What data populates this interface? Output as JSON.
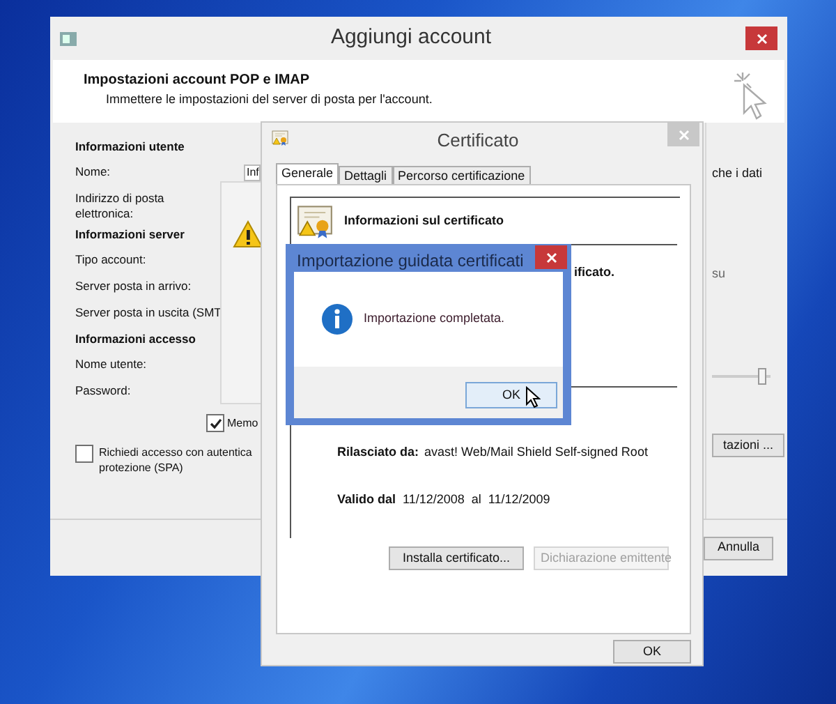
{
  "main_window": {
    "title": "Aggiungi account",
    "header_title": "Impostazioni account POP e IMAP",
    "header_subtitle": "Immettere le impostazioni del server di posta per l'account.",
    "form_rows": [
      {
        "kind": "heading",
        "text": "Informazioni utente"
      },
      {
        "kind": "label",
        "text": "Nome:"
      },
      {
        "kind": "label",
        "text": "Indirizzo di posta elettronica:"
      },
      {
        "kind": "heading",
        "text": "Informazioni server"
      },
      {
        "kind": "label",
        "text": "Tipo account:"
      },
      {
        "kind": "label",
        "text": "Server posta in arrivo:"
      },
      {
        "kind": "label",
        "text": "Server posta in uscita (SMT"
      },
      {
        "kind": "heading",
        "text": "Informazioni accesso"
      },
      {
        "kind": "label",
        "text": "Nome utente:"
      },
      {
        "kind": "label",
        "text": "Password:"
      }
    ],
    "name_field": {
      "value": "Inf"
    },
    "remember_checkbox": {
      "label": "Memo",
      "checked": true
    },
    "spa_checkbox": {
      "lines": [
        "Richiedi accesso con autentica",
        "protezione (SPA)"
      ],
      "checked": false
    },
    "right_texts": [
      "che i dati",
      "su"
    ],
    "slider": {
      "level": 0.92
    },
    "settings_button": "tazioni ...",
    "cancel_button": "Annulla"
  },
  "certificate_window": {
    "title": "Certificato",
    "tabs": [
      {
        "label": "Generale",
        "selected": true
      },
      {
        "label": "Dettagli",
        "selected": false
      },
      {
        "label": "Percorso certificazione",
        "selected": false
      }
    ],
    "heading": "Informazioni sul certificato",
    "partial_text": "ificato.",
    "issued_by_label": "Rilasciato da:",
    "issued_by": "avast! Web/Mail Shield Self-signed Root",
    "valid_label": "Valido dal",
    "valid_from": "11/12/2008",
    "valid_to_label": "al",
    "valid_to": "11/12/2009",
    "buttons": [
      {
        "label": "Installa certificato...",
        "disabled": false
      },
      {
        "label": "Dichiarazione emittente",
        "disabled": true
      }
    ],
    "ok_button": "OK"
  },
  "import_dialog": {
    "title": "Importazione guidata certificati",
    "message": "Importazione completata.",
    "ok_button": "OK"
  }
}
